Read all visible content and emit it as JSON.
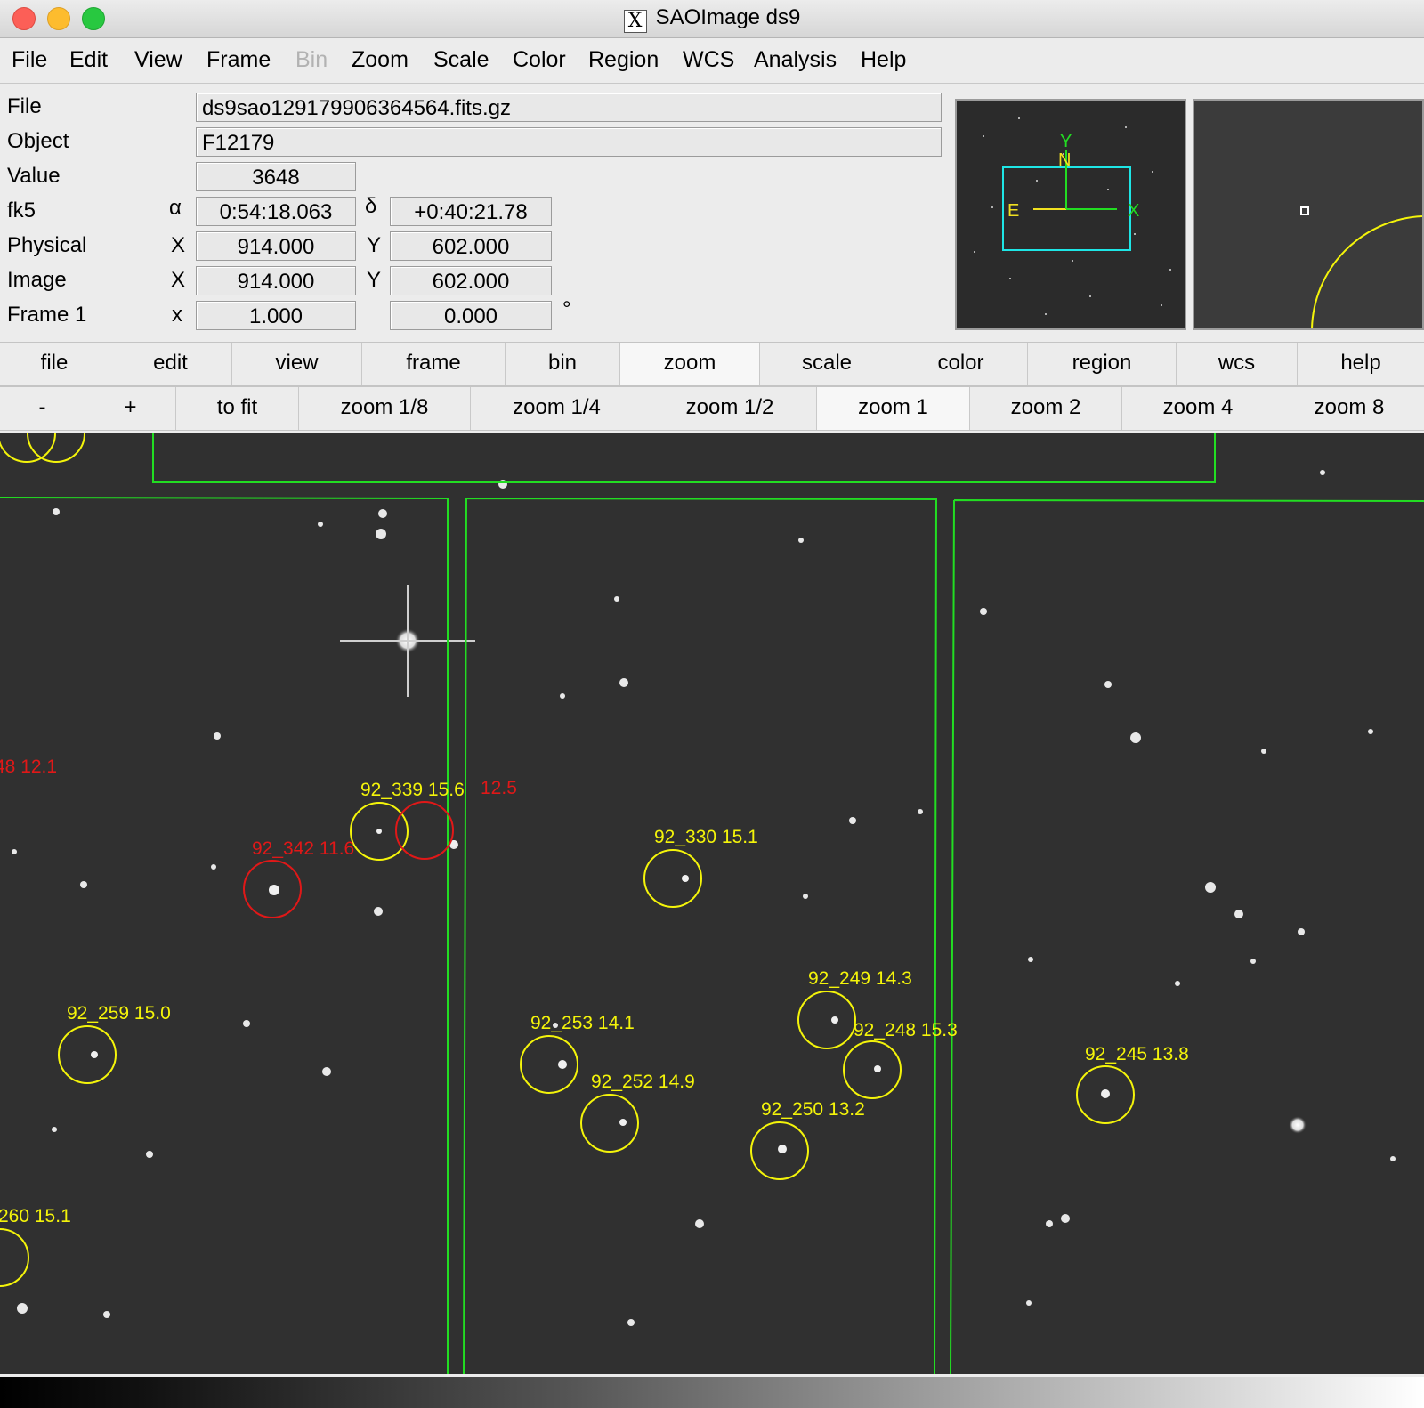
{
  "window": {
    "title": "SAOImage ds9"
  },
  "menu": [
    "File",
    "Edit",
    "View",
    "Frame",
    "Bin",
    "Zoom",
    "Scale",
    "Color",
    "Region",
    "WCS",
    "Analysis",
    "Help"
  ],
  "info": {
    "file_label": "File",
    "file_value": "ds9sao129179906364564.fits.gz",
    "object_label": "Object",
    "object_value": "F12179",
    "value_label": "Value",
    "value_value": "3648",
    "wcs_label": "fk5",
    "alpha_symbol": "α",
    "alpha_value": "0:54:18.063",
    "delta_symbol": "δ",
    "delta_value": "+0:40:21.78",
    "physical_label": "Physical",
    "physical_x_label": "X",
    "physical_x": "914.000",
    "physical_y_label": "Y",
    "physical_y": "602.000",
    "image_label": "Image",
    "image_x_label": "X",
    "image_x": "914.000",
    "image_y_label": "Y",
    "image_y": "602.000",
    "frame_label": "Frame 1",
    "frame_x_label": "x",
    "frame_zoom": "1.000",
    "frame_angle": "0.000",
    "degree_symbol": "°"
  },
  "panner": {
    "y_label": "Y",
    "n_label": "N",
    "e_label": "E",
    "x_label": "X"
  },
  "button_bar": [
    "file",
    "edit",
    "view",
    "frame",
    "bin",
    "zoom",
    "scale",
    "color",
    "region",
    "wcs",
    "help"
  ],
  "zoom_bar": [
    "-",
    "+",
    "to fit",
    "zoom 1/8",
    "zoom 1/4",
    "zoom 1/2",
    "zoom 1",
    "zoom 2",
    "zoom 4",
    "zoom 8"
  ],
  "regions": {
    "yellow": [
      "92_339 15.6",
      "92_330 15.1",
      "92_259 15.0",
      "92_253 14.1",
      "92_252 14.9",
      "92_249 14.3",
      "92_248 15.3",
      "92_250 13.2",
      "92_245 13.8",
      "260 15.1"
    ],
    "red": [
      "48 12.1",
      "92_342 11.6",
      "12.5"
    ]
  },
  "colors": {
    "region_yellow": "#f4f40a",
    "region_red": "#e01818",
    "chip_green": "#22dd22",
    "panner_cyan": "#1ee6e6"
  }
}
